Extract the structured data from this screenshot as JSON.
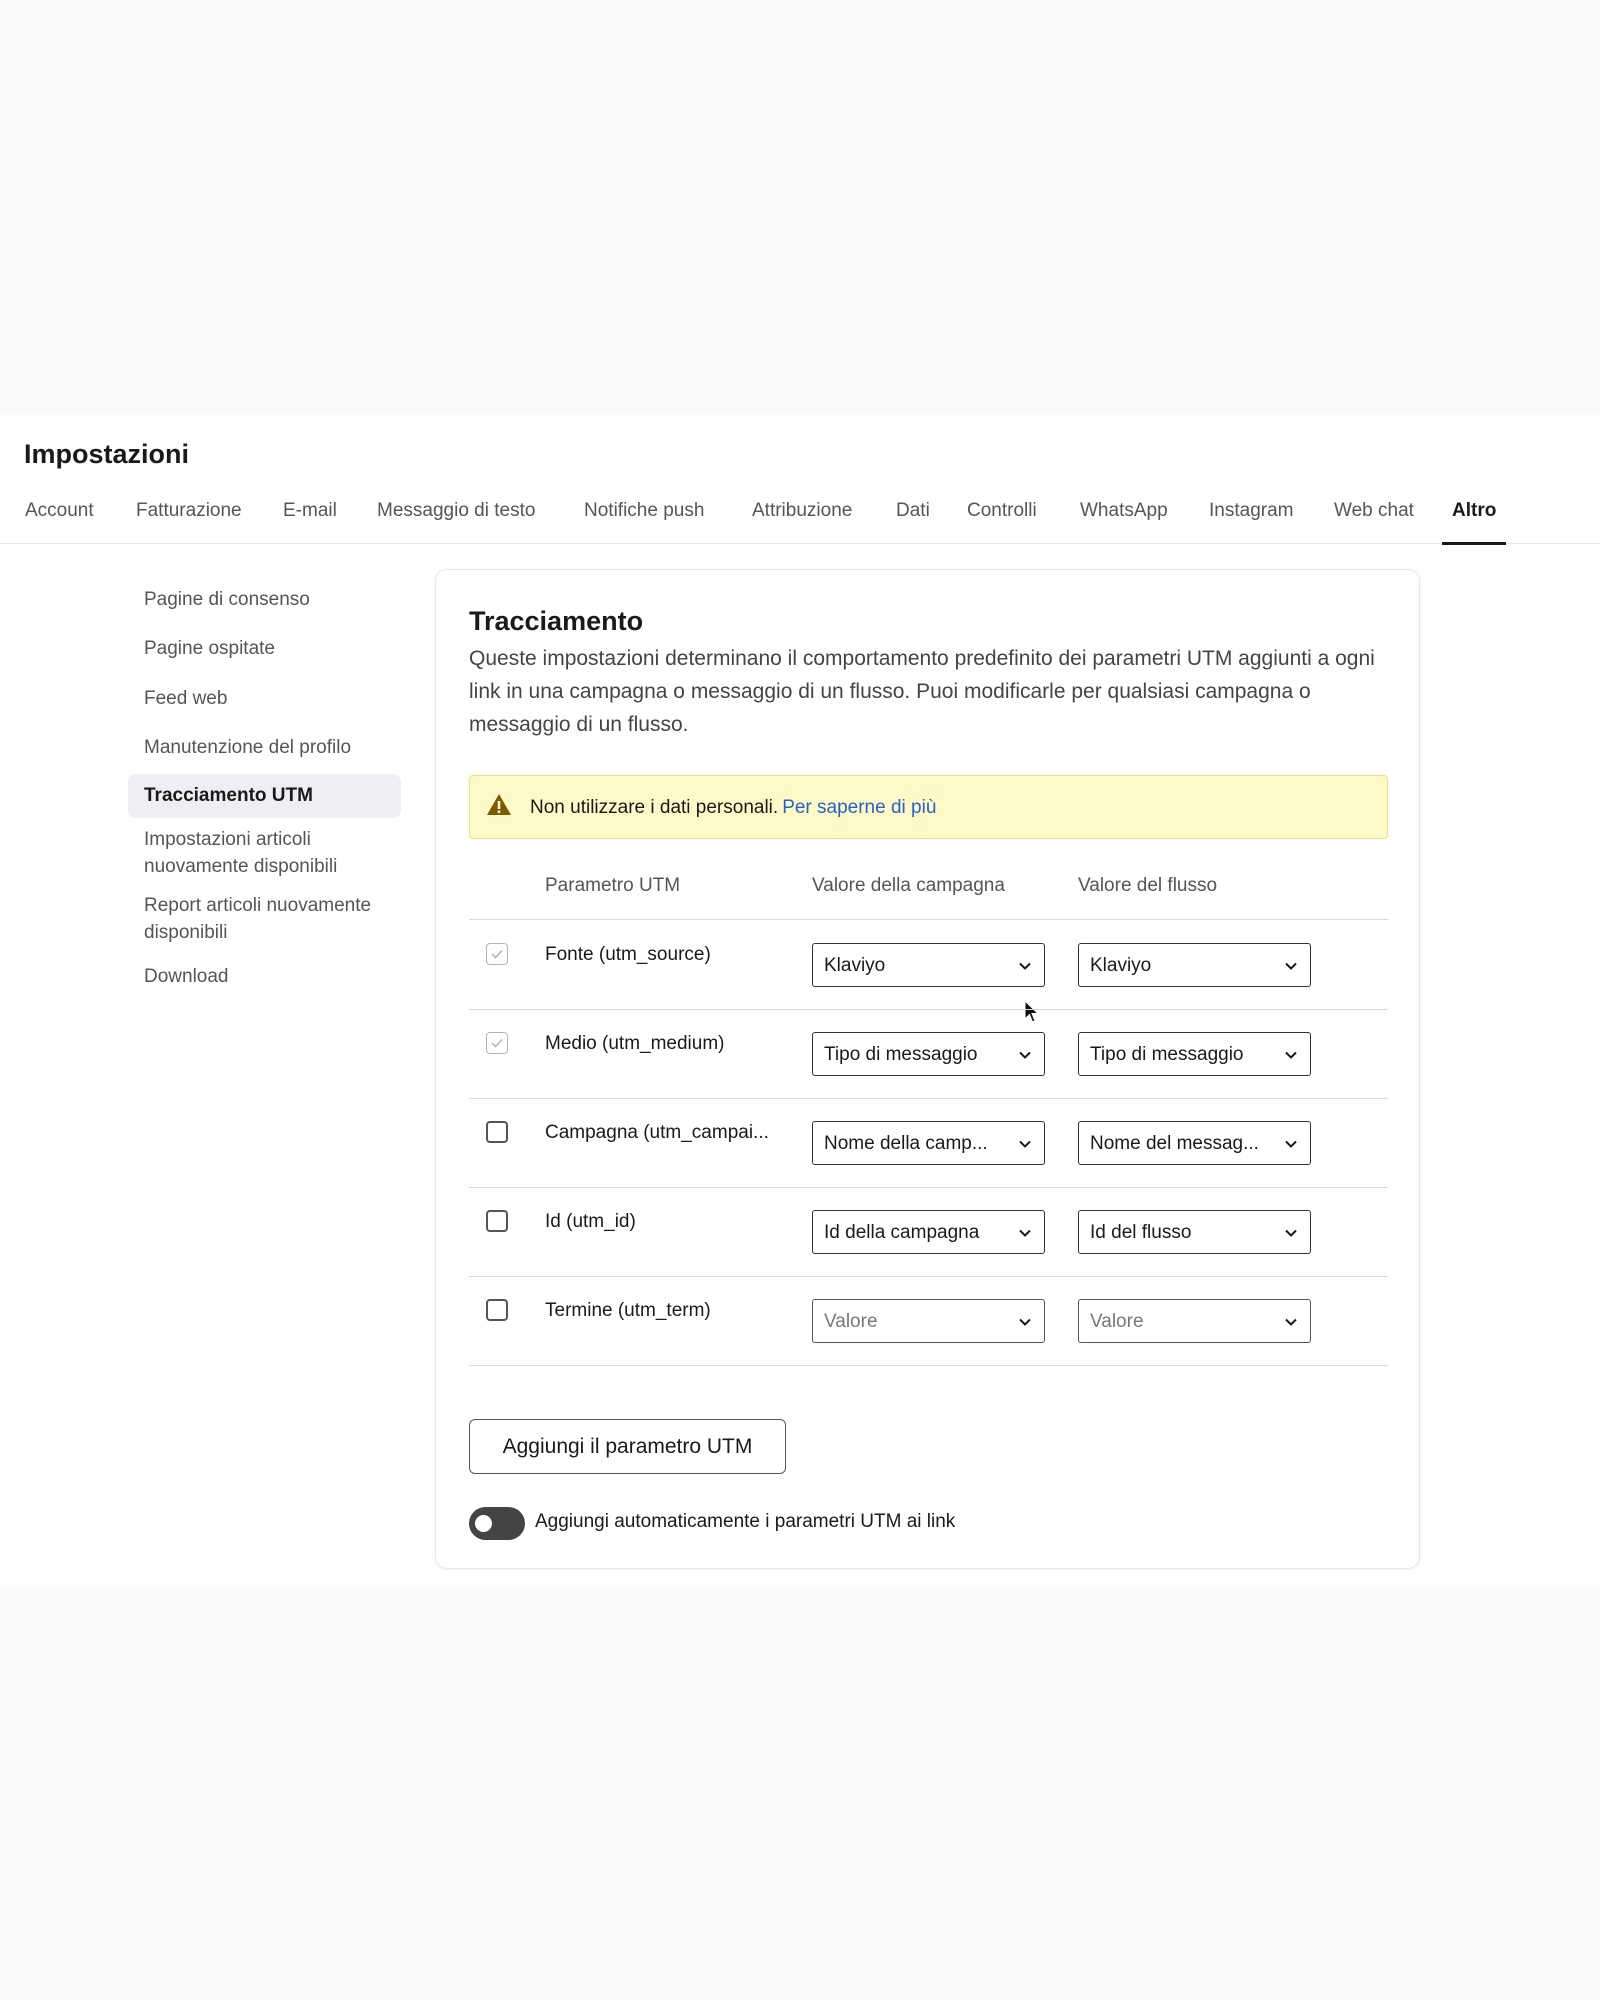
{
  "header": {
    "title": "Impostazioni"
  },
  "tabs": [
    {
      "label": "Account"
    },
    {
      "label": "Fatturazione"
    },
    {
      "label": "E-mail"
    },
    {
      "label": "Messaggio di testo"
    },
    {
      "label": "Notifiche push"
    },
    {
      "label": "Attribuzione"
    },
    {
      "label": "Dati"
    },
    {
      "label": "Controlli"
    },
    {
      "label": "WhatsApp"
    },
    {
      "label": "Instagram"
    },
    {
      "label": "Web chat"
    },
    {
      "label": "Altro",
      "active": true
    }
  ],
  "sidebar": {
    "items": [
      {
        "label": "Pagine di consenso"
      },
      {
        "label": "Pagine ospitate"
      },
      {
        "label": "Feed web"
      },
      {
        "label": "Manutenzione del profilo"
      },
      {
        "label": "Tracciamento UTM",
        "active": true
      },
      {
        "label": "Impostazioni articoli nuovamente disponibili"
      },
      {
        "label": "Report articoli nuovamente disponibili"
      },
      {
        "label": "Download"
      }
    ]
  },
  "card": {
    "title": "Tracciamento",
    "description": "Queste impostazioni determinano il comportamento predefinito dei parametri UTM aggiunti a ogni link in una campagna o messaggio di un flusso. Puoi modificarle per qualsiasi campagna o messaggio di un flusso."
  },
  "alert": {
    "icon": "warning-icon",
    "text": "Non utilizzare i dati personali.",
    "link": "Per saperne di più",
    "color": "#fff9c7"
  },
  "table": {
    "headers": {
      "param": "Parametro UTM",
      "campaign": "Valore della campagna",
      "flow": "Valore del flusso"
    },
    "rows": [
      {
        "param": "Fonte (utm_source)",
        "checked": true,
        "disabled": true,
        "campaign": "Klaviyo",
        "flow": "Klaviyo"
      },
      {
        "param": "Medio (utm_medium)",
        "checked": true,
        "disabled": true,
        "campaign": "Tipo di messaggio",
        "flow": "Tipo di messaggio"
      },
      {
        "param": "Campagna (utm_campai...",
        "checked": false,
        "disabled": false,
        "campaign": "Nome della camp...",
        "flow": "Nome del messag..."
      },
      {
        "param": "Id (utm_id)",
        "checked": false,
        "disabled": false,
        "campaign": "Id della campagna",
        "flow": "Id del flusso"
      },
      {
        "param": "Termine (utm_term)",
        "checked": false,
        "disabled": false,
        "campaign": "Valore",
        "flow": "Valore",
        "placeholder": true
      }
    ]
  },
  "add_button": {
    "label": "Aggiungi il parametro UTM"
  },
  "auto_toggle": {
    "label": "Aggiungi automaticamente i parametri UTM ai link",
    "on": false
  }
}
